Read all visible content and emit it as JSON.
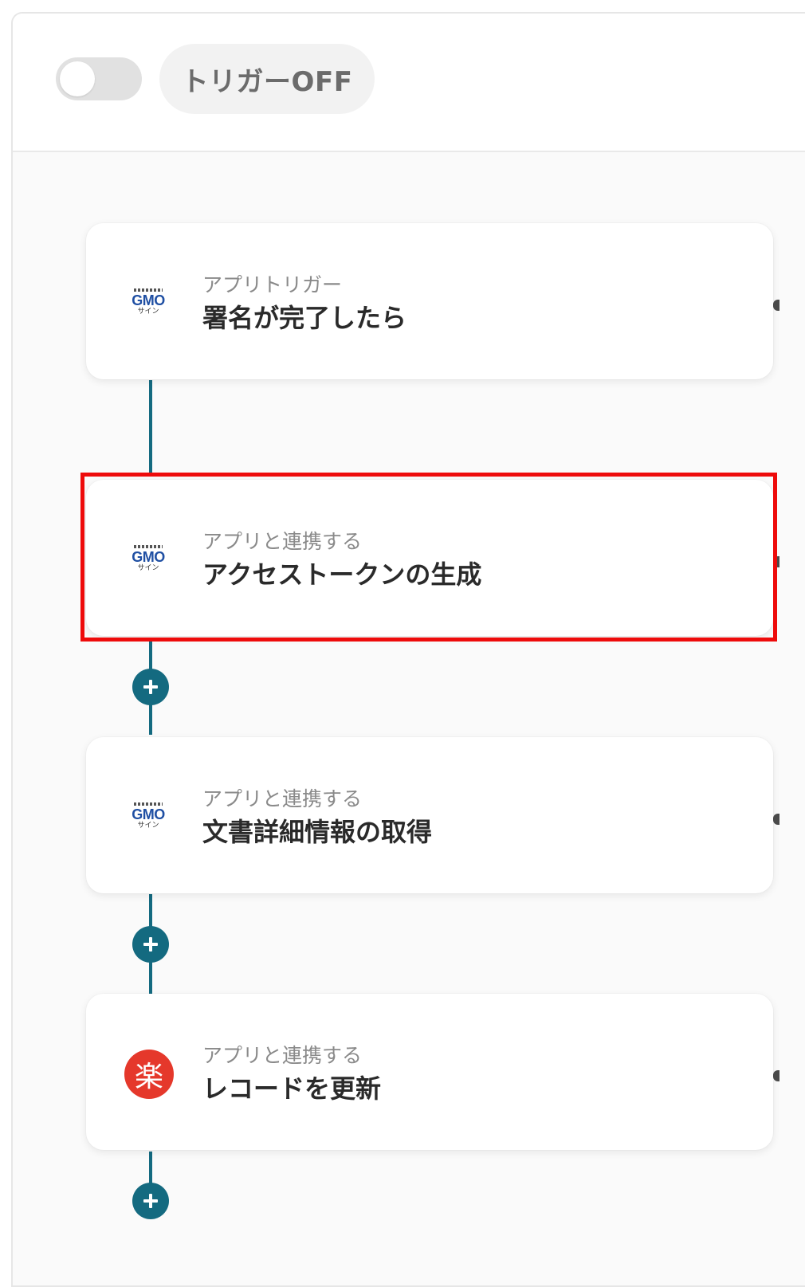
{
  "header": {
    "toggle_state": "off",
    "trigger_status_label": "トリガーOFF"
  },
  "flow": {
    "steps": [
      {
        "category": "アプリトリガー",
        "title": "署名が完了したら",
        "app_icon": "gmo-sign-logo",
        "logo_text": "GMO",
        "logo_sub": "サイン"
      },
      {
        "category": "アプリと連携する",
        "title": "アクセストークンの生成",
        "app_icon": "gmo-sign-logo",
        "logo_text": "GMO",
        "logo_sub": "サイン",
        "highlighted": true
      },
      {
        "category": "アプリと連携する",
        "title": "文書詳細情報の取得",
        "app_icon": "gmo-sign-logo",
        "logo_text": "GMO",
        "logo_sub": "サイン"
      },
      {
        "category": "アプリと連携する",
        "title": "レコードを更新",
        "app_icon": "rakuraku-logo",
        "logo_text": "楽"
      }
    ]
  },
  "colors": {
    "connector": "#146a80",
    "highlight_border": "#ee0b0b",
    "rakuraku_red": "#e5382b",
    "gmo_blue": "#1f4fa3"
  }
}
